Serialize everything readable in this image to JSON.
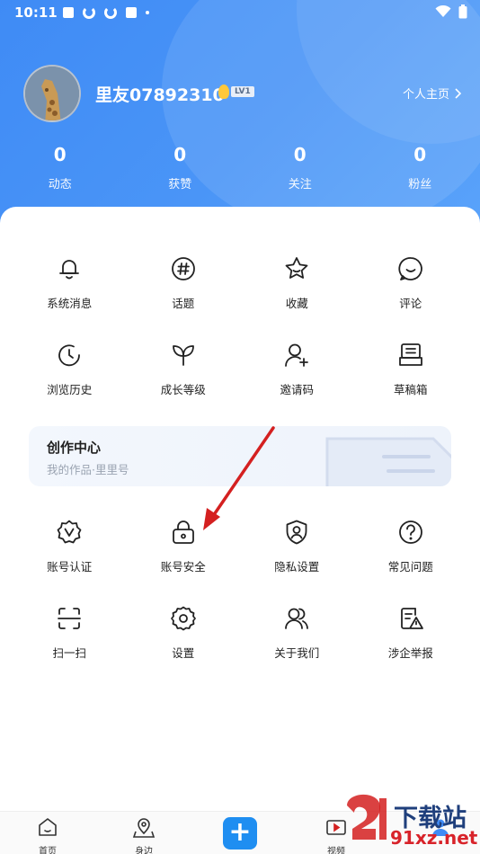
{
  "status_bar": {
    "time": "10:11"
  },
  "profile": {
    "username": "里友07892310",
    "level": "LV1",
    "homepage_link": "个人主页"
  },
  "stats": [
    {
      "value": "0",
      "label": "动态"
    },
    {
      "value": "0",
      "label": "获赞"
    },
    {
      "value": "0",
      "label": "关注"
    },
    {
      "value": "0",
      "label": "粉丝"
    }
  ],
  "grid_top": [
    {
      "label": "系统消息",
      "icon": "bell-icon"
    },
    {
      "label": "话题",
      "icon": "hashtag-icon"
    },
    {
      "label": "收藏",
      "icon": "star-icon"
    },
    {
      "label": "评论",
      "icon": "comment-icon"
    },
    {
      "label": "浏览历史",
      "icon": "history-icon"
    },
    {
      "label": "成长等级",
      "icon": "leaf-icon"
    },
    {
      "label": "邀请码",
      "icon": "add-user-icon"
    },
    {
      "label": "草稿箱",
      "icon": "drafts-icon"
    }
  ],
  "creator_center": {
    "title": "创作中心",
    "subtitle": "我的作品·里里号"
  },
  "grid_bottom": [
    {
      "label": "账号认证",
      "icon": "verified-badge-icon"
    },
    {
      "label": "账号安全",
      "icon": "lock-icon"
    },
    {
      "label": "隐私设置",
      "icon": "shield-user-icon"
    },
    {
      "label": "常见问题",
      "icon": "question-icon"
    },
    {
      "label": "扫一扫",
      "icon": "scan-icon"
    },
    {
      "label": "设置",
      "icon": "gear-icon"
    },
    {
      "label": "关于我们",
      "icon": "users-icon"
    },
    {
      "label": "涉企举报",
      "icon": "report-icon"
    }
  ],
  "bottom_nav": {
    "home": "首页",
    "nearby": "身边",
    "video": "视频"
  },
  "watermark": {
    "line1": "下载站",
    "line2": "91xz.net"
  },
  "colors": {
    "header": "#4a95f7",
    "accent": "#1f8ef1",
    "arrow": "#d42020"
  }
}
